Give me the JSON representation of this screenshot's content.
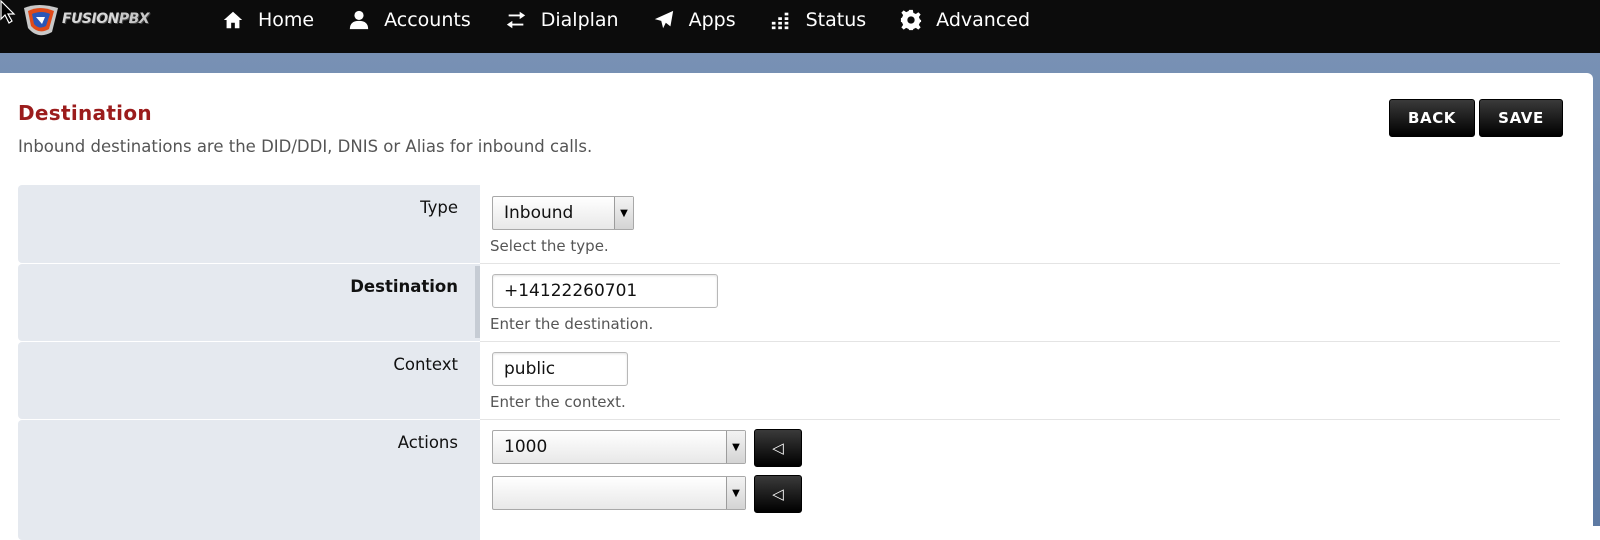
{
  "brand": {
    "name_a": "FUSION",
    "name_b": "PBX"
  },
  "nav": [
    {
      "label": "Home",
      "icon": "home-icon"
    },
    {
      "label": "Accounts",
      "icon": "user-icon"
    },
    {
      "label": "Dialplan",
      "icon": "transfer-icon"
    },
    {
      "label": "Apps",
      "icon": "paper-plane-icon"
    },
    {
      "label": "Status",
      "icon": "bar-chart-icon"
    },
    {
      "label": "Advanced",
      "icon": "gear-icon"
    }
  ],
  "page": {
    "title": "Destination",
    "description": "Inbound destinations are the DID/DDI, DNIS or Alias for inbound calls."
  },
  "buttons": {
    "back": "BACK",
    "save": "SAVE"
  },
  "form": {
    "type": {
      "label": "Type",
      "value": "Inbound",
      "hint": "Select the type."
    },
    "destination": {
      "label": "Destination",
      "value": "+14122260701",
      "hint": "Enter the destination."
    },
    "context": {
      "label": "Context",
      "value": "public",
      "hint": "Enter the context."
    },
    "actions": {
      "label": "Actions",
      "action_1": "1000",
      "action_2": "",
      "add_symbol": "◁"
    }
  },
  "colors": {
    "accent": "#9b1c1c",
    "topbar": "#0c0c0c",
    "band": "#6b86ad",
    "label_bg": "#e5e9ef"
  }
}
